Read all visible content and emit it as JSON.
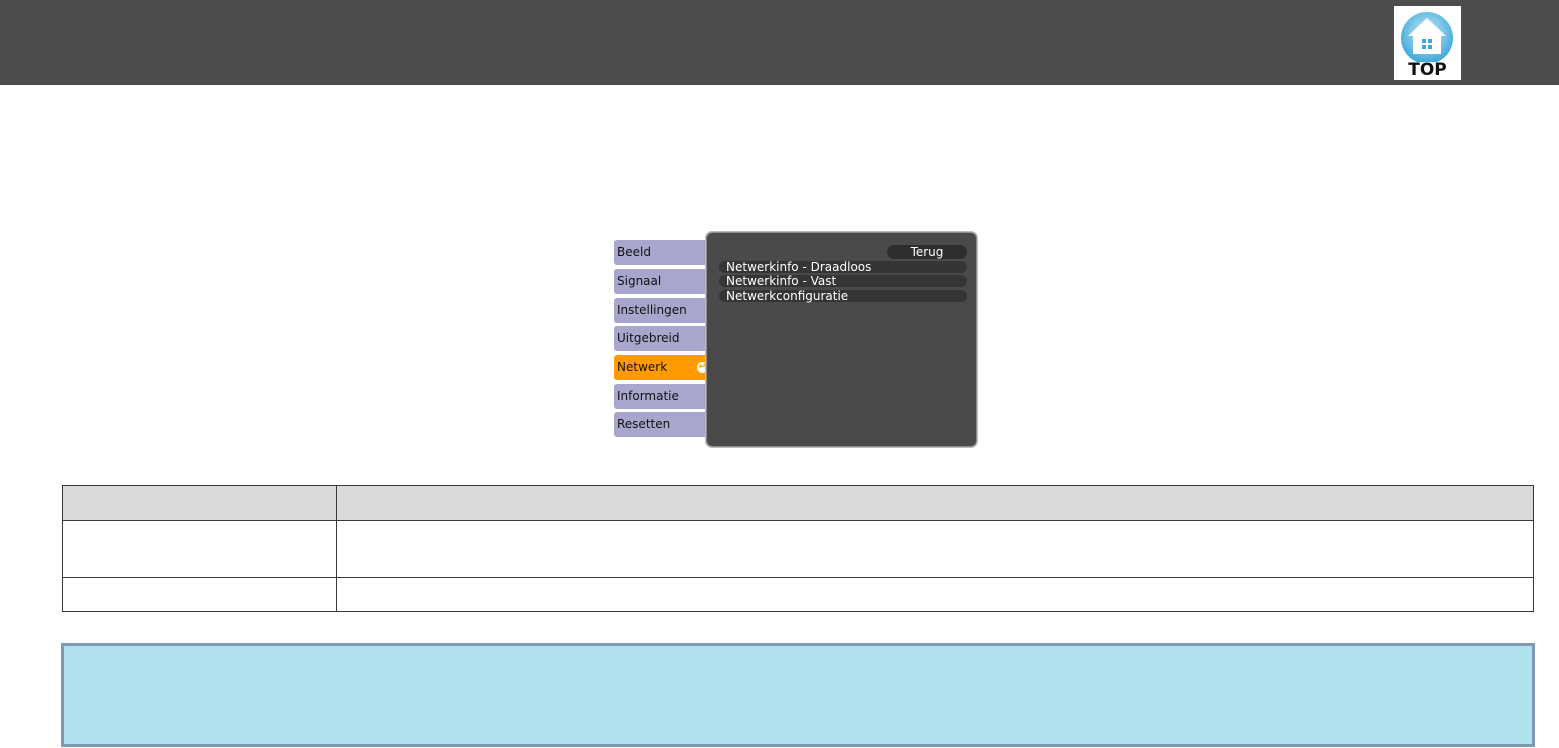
{
  "header": {
    "logo_text": "TOP"
  },
  "osd_menu": {
    "tabs": [
      {
        "label": "Beeld",
        "active": false
      },
      {
        "label": "Signaal",
        "active": false
      },
      {
        "label": "Instellingen",
        "active": false
      },
      {
        "label": "Uitgebreid",
        "active": false
      },
      {
        "label": "Netwerk",
        "active": true
      },
      {
        "label": "Informatie",
        "active": false
      },
      {
        "label": "Resetten",
        "active": false
      }
    ],
    "back_label": "Terug",
    "items": [
      {
        "label": "Netwerkinfo - Draadloos"
      },
      {
        "label": "Netwerkinfo - Vast"
      },
      {
        "label": "Netwerkconfiguratie"
      }
    ]
  },
  "table": {
    "header": [
      "",
      ""
    ],
    "rows": [
      [
        "",
        ""
      ],
      [
        "",
        ""
      ]
    ]
  },
  "colors": {
    "header_bg": "#4d4d4d",
    "tab_bg": "#a8a6cc",
    "tab_active": "#ff9a00",
    "panel_bg": "#4a4a4a",
    "note_bg": "#b0e2ee",
    "note_border": "#7f98b4"
  }
}
